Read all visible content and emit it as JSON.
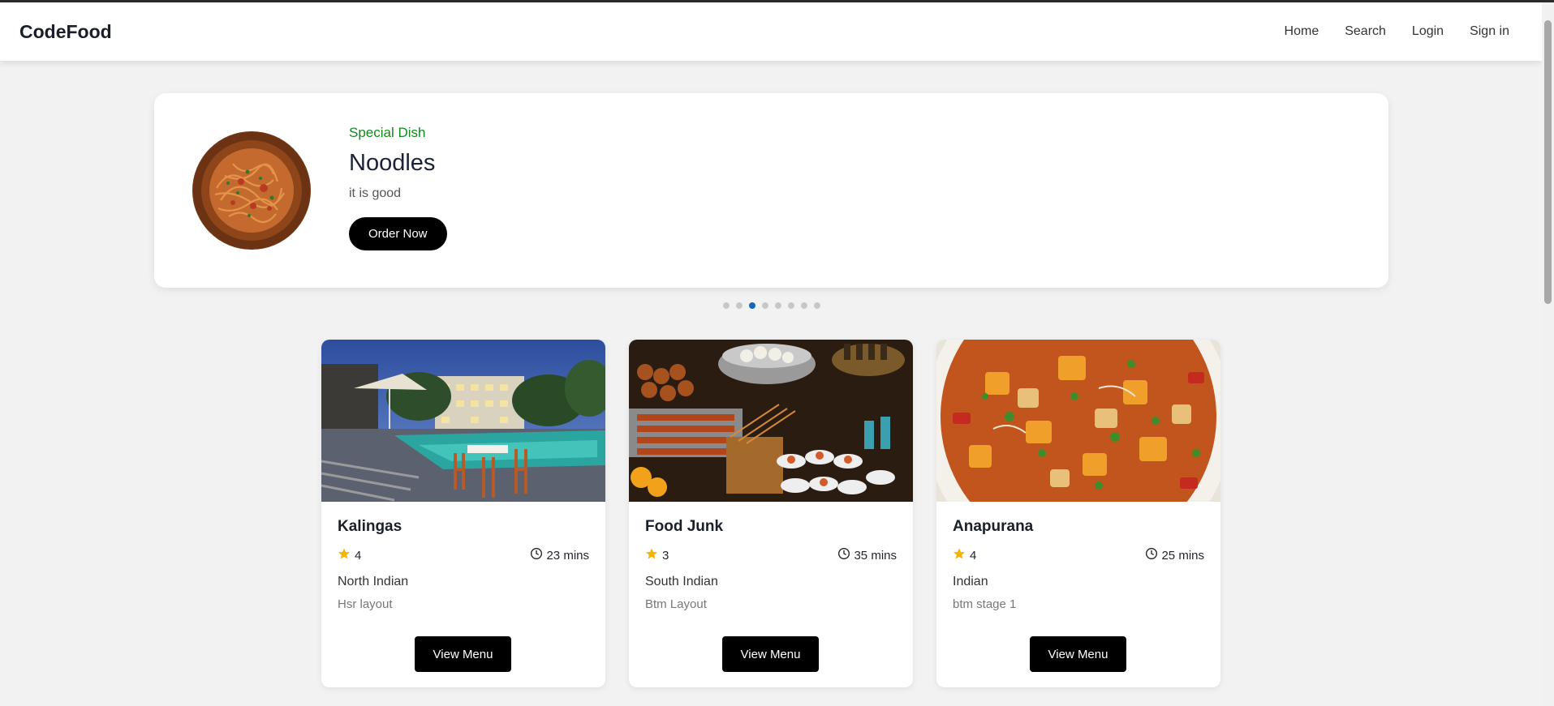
{
  "brand": "CodeFood",
  "nav": {
    "home": "Home",
    "search": "Search",
    "login": "Login",
    "signin": "Sign in"
  },
  "hero": {
    "tag": "Special Dish",
    "title": "Noodles",
    "description": "it is good",
    "button": "Order Now",
    "image_icon": "noodles-plate-image"
  },
  "carousel": {
    "count": 8,
    "active_index": 2,
    "active_color": "#1565c0"
  },
  "restaurants": [
    {
      "name": "Kalingas",
      "rating": "4",
      "time": "23 mins",
      "cuisine": "North Indian",
      "location": "Hsr layout",
      "button": "View Menu",
      "image_icon": "poolside-restaurant-image"
    },
    {
      "name": "Food Junk",
      "rating": "3",
      "time": "35 mins",
      "cuisine": "South Indian",
      "location": "Btm Layout",
      "button": "View Menu",
      "image_icon": "street-food-image"
    },
    {
      "name": "Anapurana",
      "rating": "4",
      "time": "25 mins",
      "cuisine": "Indian",
      "location": "btm stage 1",
      "button": "View Menu",
      "image_icon": "curry-bowl-image"
    }
  ],
  "colors": {
    "accent_green": "#12891d",
    "star": "#f5b400",
    "button": "#000000"
  }
}
